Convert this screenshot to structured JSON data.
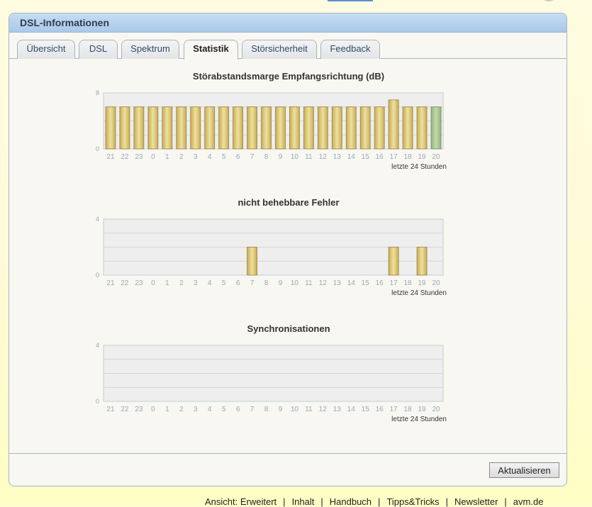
{
  "panel": {
    "title": "DSL-Informationen"
  },
  "tabs": [
    {
      "label": "Übersicht",
      "active": false
    },
    {
      "label": "DSL",
      "active": false
    },
    {
      "label": "Spektrum",
      "active": false
    },
    {
      "label": "Statistik",
      "active": true
    },
    {
      "label": "Störsicherheit",
      "active": false
    },
    {
      "label": "Feedback",
      "active": false
    }
  ],
  "colors": {
    "bar_gold": "#d8c36e",
    "bar_current": "#a9c48f",
    "grid_bg": "#eeeeee",
    "axis_text": "#9aa8b4"
  },
  "chart_data": [
    {
      "type": "bar",
      "title": "Störabstandsmarge Empfangsrichtung (dB)",
      "categories": [
        "21",
        "22",
        "23",
        "0",
        "1",
        "2",
        "3",
        "4",
        "5",
        "6",
        "7",
        "8",
        "9",
        "10",
        "11",
        "12",
        "13",
        "14",
        "15",
        "16",
        "17",
        "18",
        "19",
        "20"
      ],
      "values": [
        6,
        6,
        6,
        6,
        6,
        6,
        6,
        6,
        6,
        6,
        6,
        6,
        6,
        6,
        6,
        6,
        6,
        6,
        6,
        6,
        7,
        6,
        6,
        6
      ],
      "ylim": [
        0,
        8
      ],
      "yticks": [
        "8",
        "0"
      ],
      "xlabel": "letzte 24 Stunden",
      "highlight_index": 23
    },
    {
      "type": "bar",
      "title": "nicht behebbare Fehler",
      "categories": [
        "21",
        "22",
        "23",
        "0",
        "1",
        "2",
        "3",
        "4",
        "5",
        "6",
        "7",
        "8",
        "9",
        "10",
        "11",
        "12",
        "13",
        "14",
        "15",
        "16",
        "17",
        "18",
        "19",
        "20"
      ],
      "values": [
        0,
        0,
        0,
        0,
        0,
        0,
        0,
        0,
        0,
        0,
        2,
        0,
        0,
        0,
        0,
        0,
        0,
        0,
        0,
        0,
        2,
        0,
        2,
        0
      ],
      "ylim": [
        0,
        4
      ],
      "yticks": [
        "4",
        "0"
      ],
      "xlabel": "letzte 24 Stunden",
      "highlight_index": -1
    },
    {
      "type": "bar",
      "title": "Synchronisationen",
      "categories": [
        "21",
        "22",
        "23",
        "0",
        "1",
        "2",
        "3",
        "4",
        "5",
        "6",
        "7",
        "8",
        "9",
        "10",
        "11",
        "12",
        "13",
        "14",
        "15",
        "16",
        "17",
        "18",
        "19",
        "20"
      ],
      "values": [
        0,
        0,
        0,
        0,
        0,
        0,
        0,
        0,
        0,
        0,
        0,
        0,
        0,
        0,
        0,
        0,
        0,
        0,
        0,
        0,
        0,
        0,
        0,
        0
      ],
      "ylim": [
        0,
        4
      ],
      "yticks": [
        "4",
        "0"
      ],
      "xlabel": "letzte 24 Stunden",
      "highlight_index": -1
    }
  ],
  "actions": {
    "refresh_label": "Aktualisieren"
  },
  "footer": {
    "prefix": "Ansicht:",
    "links": [
      "Erweitert",
      "Inhalt",
      "Handbuch",
      "Tipps&Tricks",
      "Newsletter",
      "avm.de"
    ]
  }
}
